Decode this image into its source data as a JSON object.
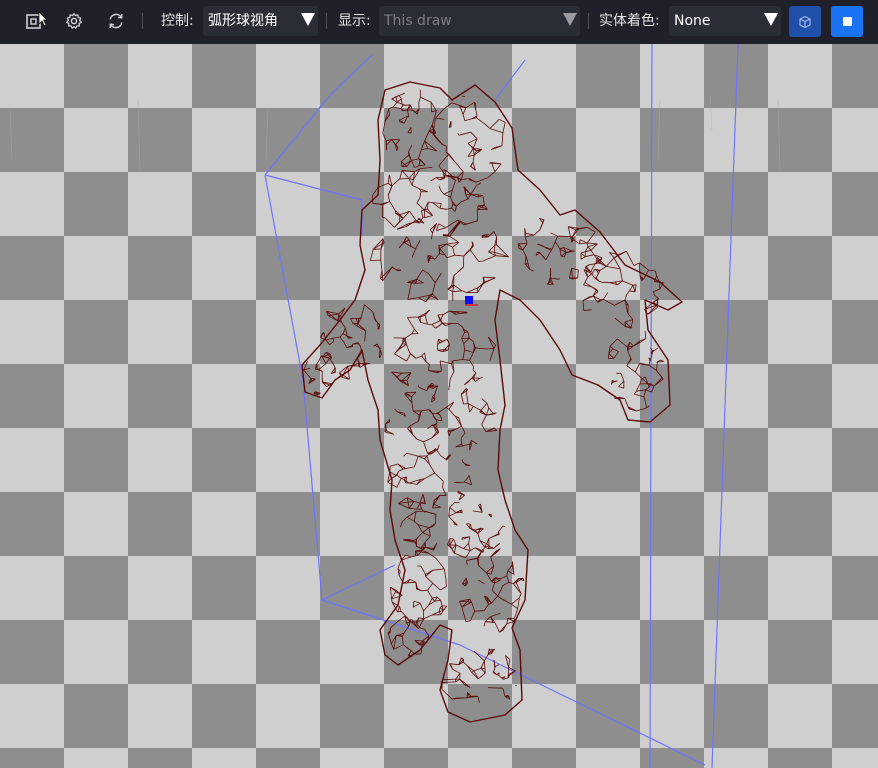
{
  "toolbar": {
    "control_label": "控制:",
    "control_value": "弧形球视角",
    "display_label": "显示:",
    "display_value": "This draw",
    "shading_label": "实体着色:",
    "shading_value": "None"
  },
  "icons": {
    "export": "export-frame-icon",
    "settings": "gear-icon",
    "refresh": "refresh-icon",
    "wireframe": "wireframe-cube-icon",
    "solid": "solid-square-icon"
  },
  "colors": {
    "toolbar_bg": "#1f2029",
    "wireframe_mesh": "#5c0a0a",
    "bounding_box": "#6f74ff",
    "solid_button": "#1a73f5",
    "wire_button": "#1e50a8",
    "checker_light": "#cfcfcf",
    "checker_dark": "#8e8e8e"
  }
}
